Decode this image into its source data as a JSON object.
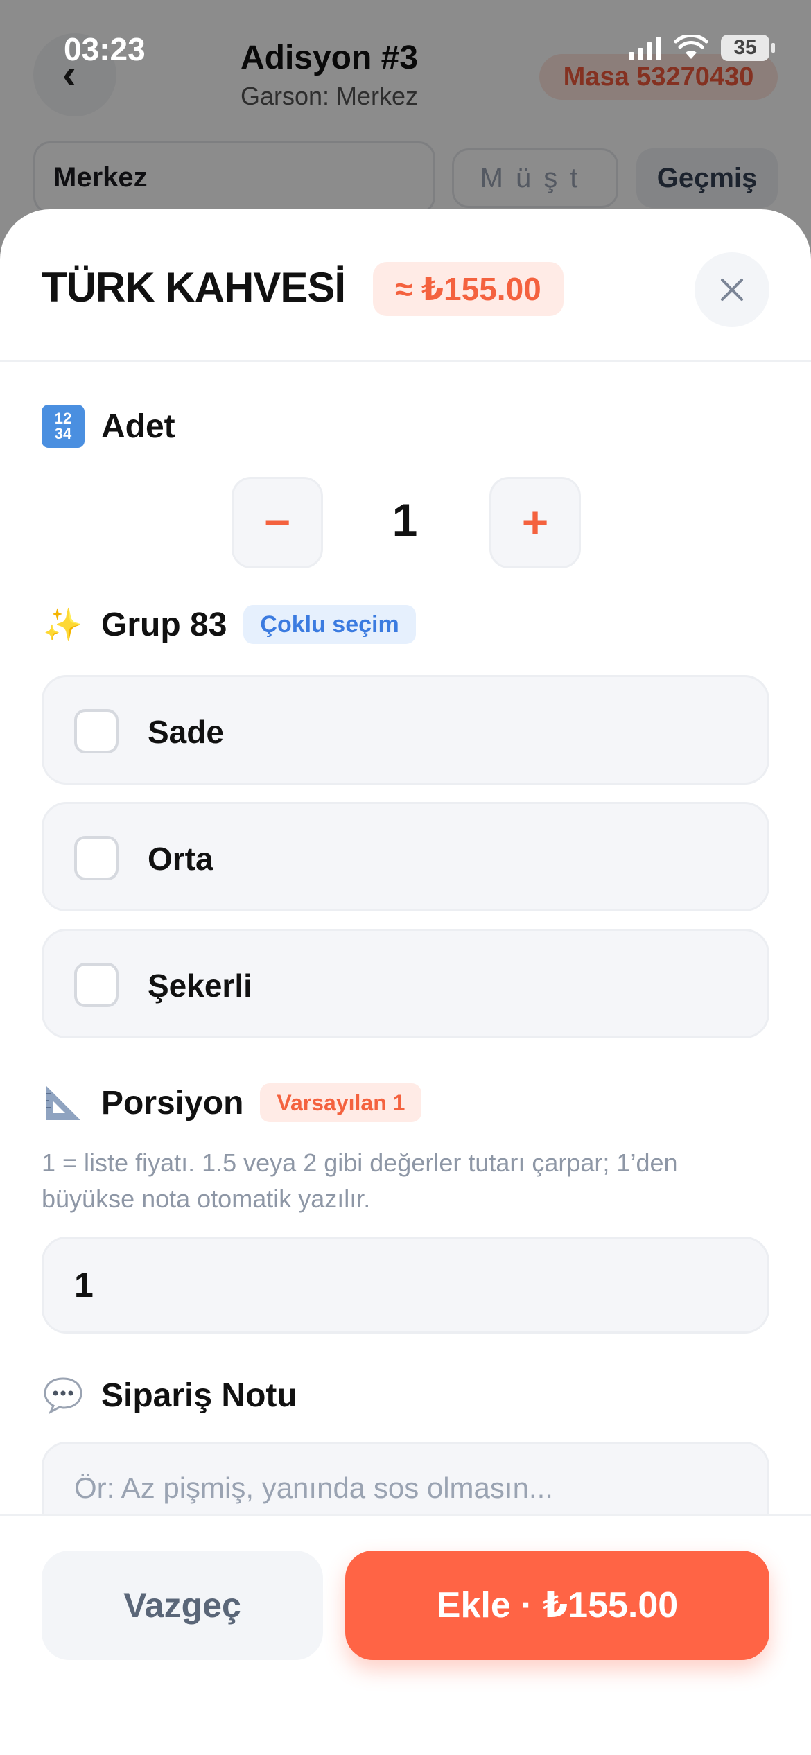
{
  "status_bar": {
    "time": "03:23",
    "battery": "35"
  },
  "background": {
    "title": "Adisyon #3",
    "subtitle": "Garson: Merkez",
    "table_badge": "Masa 53270430",
    "branch_field": "Merkez",
    "customer_placeholder": "Müşt",
    "history_button": "Geçmiş"
  },
  "sheet": {
    "product_name": "TÜRK KAHVESİ",
    "price_badge": "≈ ₺155.00",
    "quantity": {
      "title": "Adet",
      "minus": "−",
      "value": "1",
      "plus": "+"
    },
    "group": {
      "title": "Grup 83",
      "badge": "Çoklu seçim",
      "options": [
        {
          "label": "Sade",
          "checked": false
        },
        {
          "label": "Orta",
          "checked": false
        },
        {
          "label": "Şekerli",
          "checked": false
        }
      ]
    },
    "portion": {
      "title": "Porsiyon",
      "badge": "Varsayılan 1",
      "hint": "1 = liste fiyatı. 1.5 veya 2 gibi değerler tutarı çarpar; 1’den büyükse nota otomatik yazılır.",
      "value": "1"
    },
    "note": {
      "title": "Sipariş Notu",
      "placeholder": "Ör: Az pişmiş, yanında sos olmasın..."
    },
    "footer": {
      "cancel": "Vazgeç",
      "add": "Ekle · ₺155.00"
    }
  },
  "colors": {
    "accent": "#ff6445",
    "blue": "#3b7be0"
  },
  "icons": [
    "back-chevron-icon",
    "close-icon",
    "input-numbers-icon",
    "sparkles-icon",
    "triangular-ruler-icon",
    "speech-bubble-icon",
    "checkbox-icon"
  ]
}
